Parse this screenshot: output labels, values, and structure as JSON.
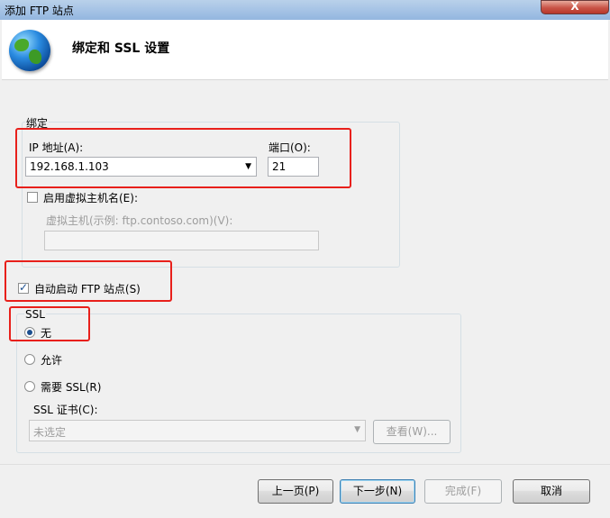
{
  "window": {
    "title": "添加 FTP 站点",
    "close_label": "X"
  },
  "header": {
    "title": "绑定和 SSL 设置"
  },
  "binding": {
    "group_label": "绑定",
    "ip_label": "IP 地址(A):",
    "ip_value": "192.168.1.103",
    "port_label": "端口(O):",
    "port_value": "21",
    "virtual_host_checkbox_label": "启用虚拟主机名(E):",
    "virtual_host_label": "虚拟主机(示例: ftp.contoso.com)(V):",
    "virtual_host_value": ""
  },
  "autostart": {
    "label": "自动启动 FTP 站点(S)",
    "checked": true
  },
  "ssl": {
    "group_label": "SSL",
    "options": [
      "无",
      "允许",
      "需要 SSL(R)"
    ],
    "selected": "无",
    "cert_label": "SSL 证书(C):",
    "cert_value": "未选定",
    "view_button": "查看(W)..."
  },
  "footer": {
    "prev": "上一页(P)",
    "next": "下一步(N)",
    "finish": "完成(F)",
    "cancel": "取消"
  },
  "colors": {
    "highlight": "#e8201b",
    "header_bg": "#ffffff",
    "dialog_bg": "#f0f0f0"
  }
}
